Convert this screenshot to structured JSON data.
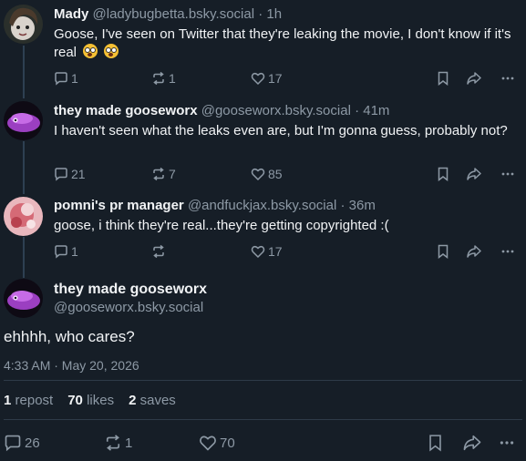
{
  "posts": [
    {
      "name": "Mady",
      "handle": "@ladybugbetta.bsky.social",
      "time": "1h",
      "text": "Goose, I've seen on Twitter that they're leaking the movie, I don't know if it's real",
      "emojis": [
        "flushed-face",
        "flushed-face"
      ],
      "replies": "1",
      "reposts": "1",
      "likes": "17"
    },
    {
      "name": "they made gooseworx",
      "handle": "@gooseworx.bsky.social",
      "time": "41m",
      "text": "I haven't seen what the leaks even are, but I'm gonna guess, probably not?",
      "replies": "21",
      "reposts": "7",
      "likes": "85"
    },
    {
      "name": "pomni's pr manager",
      "handle": "@andfuckjax.bsky.social",
      "time": "36m",
      "text": "goose, i think they're real...they're getting copyrighted :(",
      "replies": "1",
      "reposts": "",
      "likes": "17"
    }
  ],
  "main": {
    "name": "they made gooseworx",
    "handle": "@gooseworx.bsky.social",
    "text": "ehhhh, who cares?",
    "date": "4:33 AM · May 20, 2026",
    "stats": {
      "reposts_count": "1",
      "reposts_label": "repost",
      "likes_count": "70",
      "likes_label": "likes",
      "saves_count": "2",
      "saves_label": "saves"
    },
    "replies": "26",
    "reposts": "1",
    "likes": "70"
  },
  "separator": "·",
  "colors": {
    "background": "#161e27",
    "muted": "#8d99a5",
    "text": "#f1f3f5",
    "thread_line": "#2e4052"
  }
}
